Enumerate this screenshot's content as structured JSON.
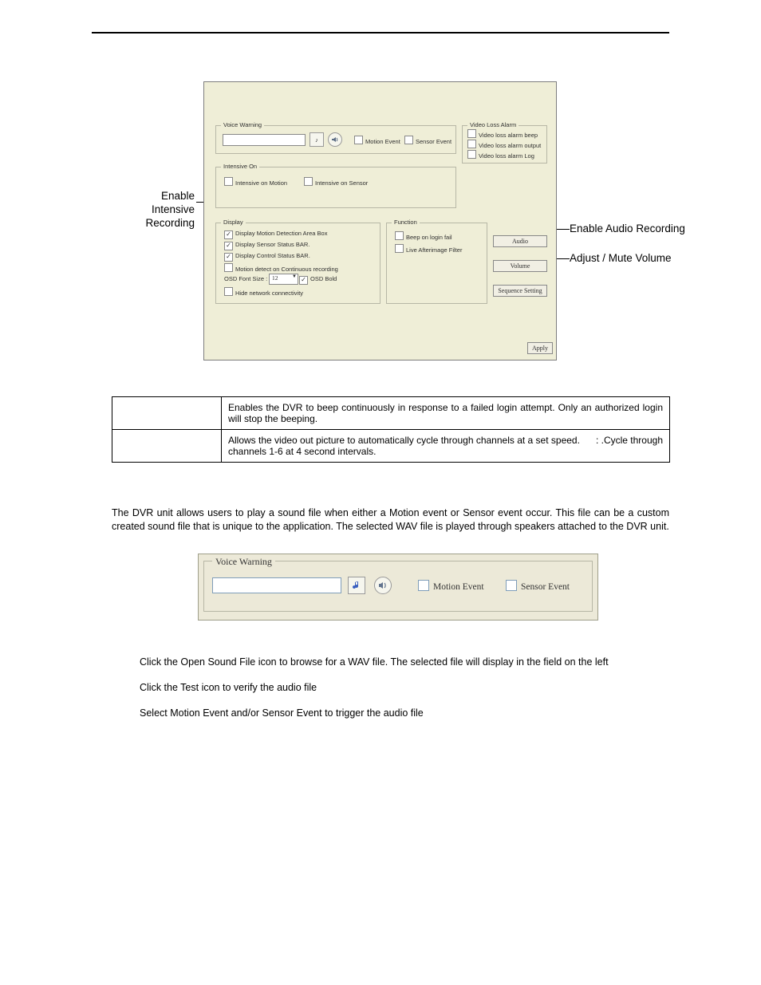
{
  "annotations": {
    "enable_intensive": "Enable Intensive\nRecording",
    "enable_audio": "Enable Audio Recording",
    "adjust_mute": "Adjust / Mute Volume",
    "open_sound_file": "Open Sound File",
    "test": "Test"
  },
  "shot1": {
    "voice_warning": {
      "legend": "Voice Warning",
      "motion_event": "Motion Event",
      "sensor_event": "Sensor Event"
    },
    "intensive_on": {
      "legend": "Intensive On",
      "intensive_motion": "Intensive on Motion",
      "intensive_sensor": "Intensive on Sensor"
    },
    "video_loss": {
      "legend": "Video Loss Alarm",
      "beep": "Video loss alarm beep",
      "output": "Video loss alarm output",
      "log": "Video loss alarm Log"
    },
    "display": {
      "legend": "Display",
      "motion_area": "Display Motion Detection Area Box",
      "sensor_bar": "Display Sensor Status BAR.",
      "control_bar": "Display Control Status BAR.",
      "motion_continuous": "Motion detect on Continuous recording",
      "osd_font_label": "OSD Font Size :",
      "osd_font_value": "12",
      "osd_bold": "OSD Bold",
      "hide_net": "Hide network connectivity"
    },
    "function": {
      "legend": "Function",
      "beep_login": "Beep on login fail",
      "afterimage": "Live Afterimage Filter"
    },
    "buttons": {
      "audio": "Audio",
      "volume": "Volume",
      "sequence": "Sequence Setting",
      "apply": "Apply"
    }
  },
  "table": {
    "r1": "Enables the DVR to beep continuously in response to a failed login attempt.  Only an authorized login will stop the beeping.",
    "r2a": "Allows the video out picture to automatically cycle through channels at a set speed.",
    "r2b": ": .Cycle through",
    "r2c": "channels 1-6 at 4 second intervals."
  },
  "para": "The DVR unit allows users to play a sound file when either a Motion event or Sensor event occur. This file can be a custom created sound file that is unique to the application. The selected WAV file is played through speakers attached to the DVR unit.",
  "shot2": {
    "legend": "Voice Warning",
    "motion_event": "Motion Event",
    "sensor_event": "Sensor Event"
  },
  "steps": {
    "s1": "Click the Open Sound File icon to browse for a WAV file.  The selected file will display in the field on the left",
    "s2": "Click the Test icon to verify the audio file",
    "s3": "Select Motion Event and/or Sensor Event to trigger the audio file"
  }
}
